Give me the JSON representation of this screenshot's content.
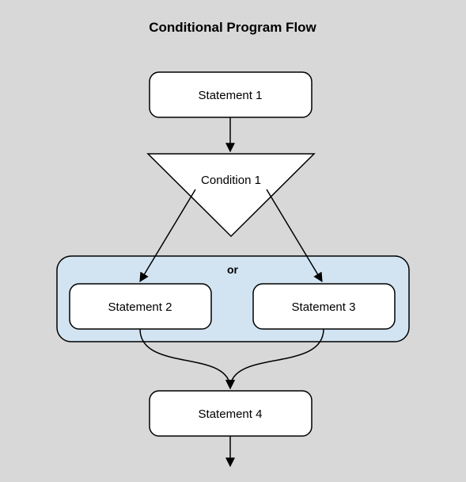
{
  "diagram": {
    "title": "Conditional Program Flow",
    "nodes": {
      "statement1": "Statement 1",
      "condition1": "Condition 1",
      "or_label": "or",
      "statement2": "Statement 2",
      "statement3": "Statement 3",
      "statement4": "Statement 4"
    },
    "edges": [
      {
        "from": "statement1",
        "to": "condition1"
      },
      {
        "from": "condition1",
        "to": "statement2"
      },
      {
        "from": "condition1",
        "to": "statement3"
      },
      {
        "from": "statement2",
        "to": "statement4"
      },
      {
        "from": "statement3",
        "to": "statement4"
      },
      {
        "from": "statement4",
        "to": "exit"
      }
    ]
  }
}
